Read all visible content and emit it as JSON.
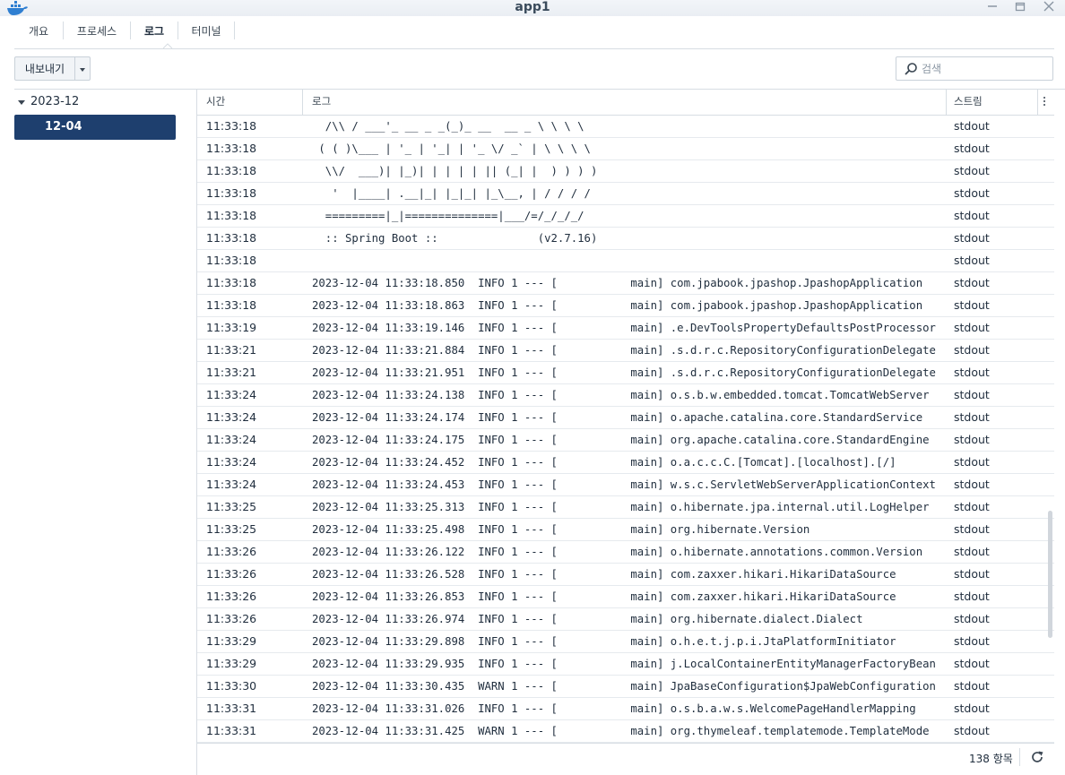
{
  "window": {
    "title": "app1"
  },
  "tabs": [
    {
      "label": "개요"
    },
    {
      "label": "프로세스"
    },
    {
      "label": "로그"
    },
    {
      "label": "터미널"
    }
  ],
  "toolbar": {
    "export_label": "내보내기",
    "search_placeholder": "검색"
  },
  "tree": {
    "year": "2023-12",
    "day": "12-04"
  },
  "grid": {
    "headers": {
      "time": "시간",
      "log": "로그",
      "stream": "스트림"
    },
    "rows": [
      {
        "time": "11:33:18",
        "log": "  /\\\\ / ___'_ __ _ _(_)_ __  __ _ \\ \\ \\ \\",
        "stream": "stdout"
      },
      {
        "time": "11:33:18",
        "log": " ( ( )\\___ | '_ | '_| | '_ \\/ _` | \\ \\ \\ \\",
        "stream": "stdout"
      },
      {
        "time": "11:33:18",
        "log": "  \\\\/  ___)| |_)| | | | | || (_| |  ) ) ) )",
        "stream": "stdout"
      },
      {
        "time": "11:33:18",
        "log": "   '  |____| .__|_| |_|_| |_\\__, | / / / /",
        "stream": "stdout"
      },
      {
        "time": "11:33:18",
        "log": "  =========|_|==============|___/=/_/_/_/",
        "stream": "stdout"
      },
      {
        "time": "11:33:18",
        "log": "  :: Spring Boot ::               (v2.7.16)",
        "stream": "stdout"
      },
      {
        "time": "11:33:18",
        "log": "",
        "stream": "stdout"
      },
      {
        "time": "11:33:18",
        "log": "2023-12-04 11:33:18.850  INFO 1 --- [           main] com.jpabook.jpashop.JpashopApplication",
        "stream": "stdout"
      },
      {
        "time": "11:33:18",
        "log": "2023-12-04 11:33:18.863  INFO 1 --- [           main] com.jpabook.jpashop.JpashopApplication",
        "stream": "stdout"
      },
      {
        "time": "11:33:19",
        "log": "2023-12-04 11:33:19.146  INFO 1 --- [           main] .e.DevToolsPropertyDefaultsPostProcessor",
        "stream": "stdout"
      },
      {
        "time": "11:33:21",
        "log": "2023-12-04 11:33:21.884  INFO 1 --- [           main] .s.d.r.c.RepositoryConfigurationDelegate",
        "stream": "stdout"
      },
      {
        "time": "11:33:21",
        "log": "2023-12-04 11:33:21.951  INFO 1 --- [           main] .s.d.r.c.RepositoryConfigurationDelegate",
        "stream": "stdout"
      },
      {
        "time": "11:33:24",
        "log": "2023-12-04 11:33:24.138  INFO 1 --- [           main] o.s.b.w.embedded.tomcat.TomcatWebServer",
        "stream": "stdout"
      },
      {
        "time": "11:33:24",
        "log": "2023-12-04 11:33:24.174  INFO 1 --- [           main] o.apache.catalina.core.StandardService",
        "stream": "stdout"
      },
      {
        "time": "11:33:24",
        "log": "2023-12-04 11:33:24.175  INFO 1 --- [           main] org.apache.catalina.core.StandardEngine",
        "stream": "stdout"
      },
      {
        "time": "11:33:24",
        "log": "2023-12-04 11:33:24.452  INFO 1 --- [           main] o.a.c.c.C.[Tomcat].[localhost].[/]",
        "stream": "stdout"
      },
      {
        "time": "11:33:24",
        "log": "2023-12-04 11:33:24.453  INFO 1 --- [           main] w.s.c.ServletWebServerApplicationContext",
        "stream": "stdout"
      },
      {
        "time": "11:33:25",
        "log": "2023-12-04 11:33:25.313  INFO 1 --- [           main] o.hibernate.jpa.internal.util.LogHelper",
        "stream": "stdout"
      },
      {
        "time": "11:33:25",
        "log": "2023-12-04 11:33:25.498  INFO 1 --- [           main] org.hibernate.Version                   ",
        "stream": "stdout"
      },
      {
        "time": "11:33:26",
        "log": "2023-12-04 11:33:26.122  INFO 1 --- [           main] o.hibernate.annotations.common.Version",
        "stream": "stdout"
      },
      {
        "time": "11:33:26",
        "log": "2023-12-04 11:33:26.528  INFO 1 --- [           main] com.zaxxer.hikari.HikariDataSource",
        "stream": "stdout"
      },
      {
        "time": "11:33:26",
        "log": "2023-12-04 11:33:26.853  INFO 1 --- [           main] com.zaxxer.hikari.HikariDataSource",
        "stream": "stdout"
      },
      {
        "time": "11:33:26",
        "log": "2023-12-04 11:33:26.974  INFO 1 --- [           main] org.hibernate.dialect.Dialect          ",
        "stream": "stdout"
      },
      {
        "time": "11:33:29",
        "log": "2023-12-04 11:33:29.898  INFO 1 --- [           main] o.h.e.t.j.p.i.JtaPlatformInitiator",
        "stream": "stdout"
      },
      {
        "time": "11:33:29",
        "log": "2023-12-04 11:33:29.935  INFO 1 --- [           main] j.LocalContainerEntityManagerFactoryBean",
        "stream": "stdout"
      },
      {
        "time": "11:33:30",
        "log": "2023-12-04 11:33:30.435  WARN 1 --- [           main] JpaBaseConfiguration$JpaWebConfiguration",
        "stream": "stdout"
      },
      {
        "time": "11:33:31",
        "log": "2023-12-04 11:33:31.026  INFO 1 --- [           main] o.s.b.a.w.s.WelcomePageHandlerMapping",
        "stream": "stdout"
      },
      {
        "time": "11:33:31",
        "log": "2023-12-04 11:33:31.425  WARN 1 --- [           main] org.thymeleaf.templatemode.TemplateMode",
        "stream": "stdout"
      }
    ]
  },
  "footer": {
    "count": "138 항목"
  },
  "colors": {
    "accent": "#1e3f6e",
    "border": "#d7dde3",
    "text": "#1f2d3d"
  },
  "icons": [
    "docker-logo-icon",
    "minimize-icon",
    "maximize-icon",
    "close-icon",
    "chevron-down-icon",
    "search-icon",
    "more-vertical-icon",
    "refresh-icon"
  ]
}
